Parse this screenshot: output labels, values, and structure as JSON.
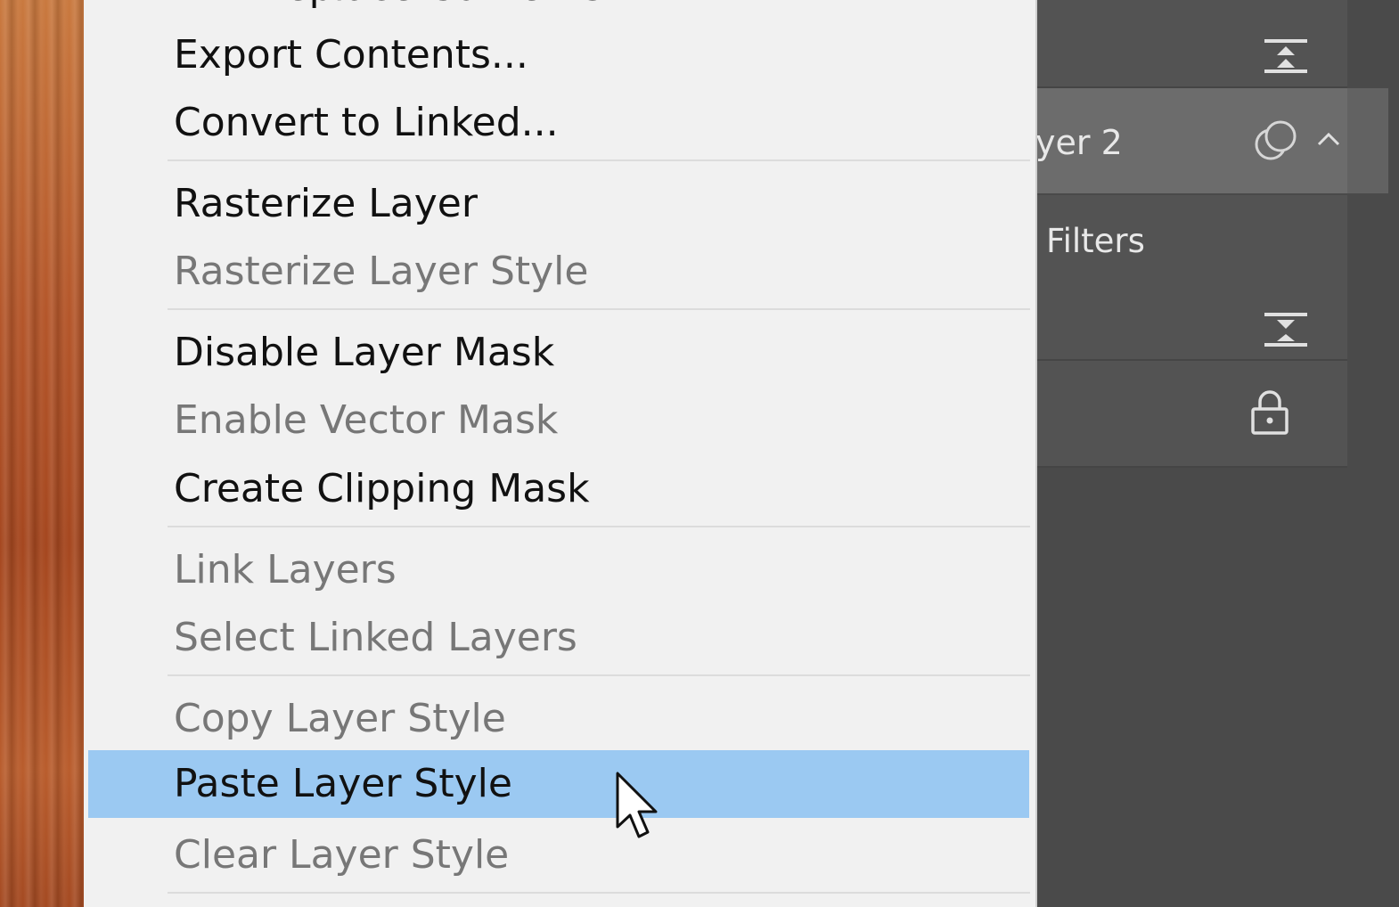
{
  "context_menu": {
    "partial_top_item": "Replace Contents...",
    "groups": [
      [
        {
          "label": "Export Contents...",
          "enabled": true
        },
        {
          "label": "Convert to Linked...",
          "enabled": true
        }
      ],
      [
        {
          "label": "Rasterize Layer",
          "enabled": true
        },
        {
          "label": "Rasterize Layer Style",
          "enabled": false
        }
      ],
      [
        {
          "label": "Disable Layer Mask",
          "enabled": true
        },
        {
          "label": "Enable Vector Mask",
          "enabled": false
        },
        {
          "label": "Create Clipping Mask",
          "enabled": true
        }
      ],
      [
        {
          "label": "Link Layers",
          "enabled": false
        },
        {
          "label": "Select Linked Layers",
          "enabled": false
        }
      ],
      [
        {
          "label": "Copy Layer Style",
          "enabled": false
        },
        {
          "label": "Paste Layer Style",
          "enabled": true,
          "highlighted": true
        },
        {
          "label": "Clear Layer Style",
          "enabled": false
        }
      ]
    ],
    "highlight_color": "#9bc9f2"
  },
  "layers_panel": {
    "layer_name": "yer 2",
    "smart_filters_label": "Filters",
    "icons": [
      "align-filter-icon",
      "smart-object-icon",
      "chevron-up-icon",
      "align-filter-icon",
      "lock-icon"
    ]
  }
}
